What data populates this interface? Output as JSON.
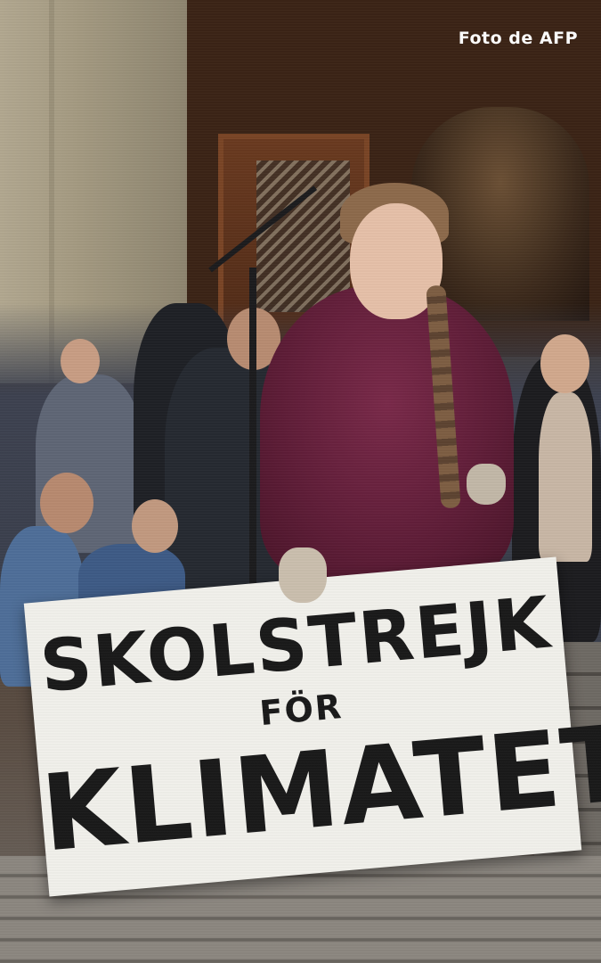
{
  "photo": {
    "credit": "Foto de AFP"
  },
  "sign": {
    "line1": "SKOLSTREJK",
    "line2": "FÖR",
    "line3": "KLIMATET"
  },
  "colors": {
    "jacket": "#5e1d37",
    "sign": "#f2f1ec",
    "sign_text": "#1a1a1a",
    "credit_text": "#ffffff"
  }
}
